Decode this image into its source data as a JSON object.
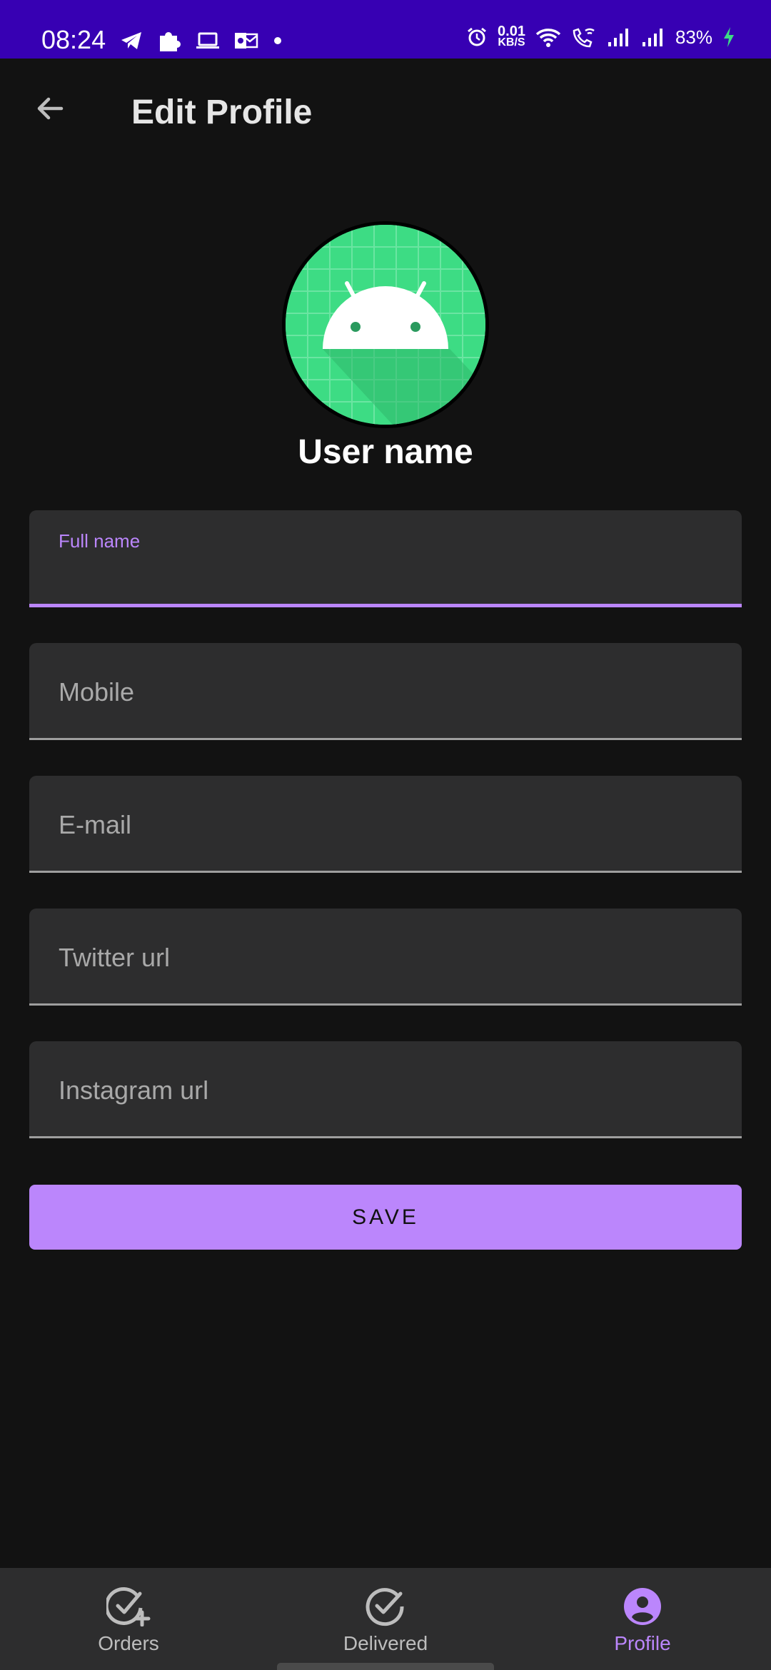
{
  "status_bar": {
    "time": "08:24",
    "net_speed_value": "0.01",
    "net_speed_unit": "KB/S",
    "battery": "83%",
    "icons": [
      "telegram-icon",
      "puzzle-icon",
      "laptop-icon",
      "outlook-icon",
      "notification-dot-icon",
      "alarm-icon",
      "wifi-icon",
      "wifi-calling-icon",
      "signal-icon",
      "signal-icon",
      "battery-charging-icon"
    ]
  },
  "app_bar": {
    "title": "Edit Profile",
    "back_icon": "arrow-back-icon"
  },
  "profile": {
    "avatar_icon": "android-robot-icon",
    "user_name": "User name"
  },
  "form": {
    "full_name": {
      "label": "Full name",
      "value": ""
    },
    "mobile": {
      "placeholder": "Mobile"
    },
    "email": {
      "placeholder": "E-mail"
    },
    "twitter": {
      "placeholder": "Twitter url"
    },
    "instagram": {
      "placeholder": "Instagram url"
    },
    "save_label": "SAVE"
  },
  "bottom_nav": {
    "items": [
      {
        "label": "Orders",
        "icon": "check-circle-plus-icon"
      },
      {
        "label": "Delivered",
        "icon": "check-circle-icon"
      },
      {
        "label": "Profile",
        "icon": "account-circle-icon",
        "active": true
      }
    ]
  },
  "colors": {
    "status_bar": "#3700b3",
    "background": "#121212",
    "surface": "#2d2d2e",
    "accent": "#bb86fc",
    "android_green": "#3ddc84"
  }
}
